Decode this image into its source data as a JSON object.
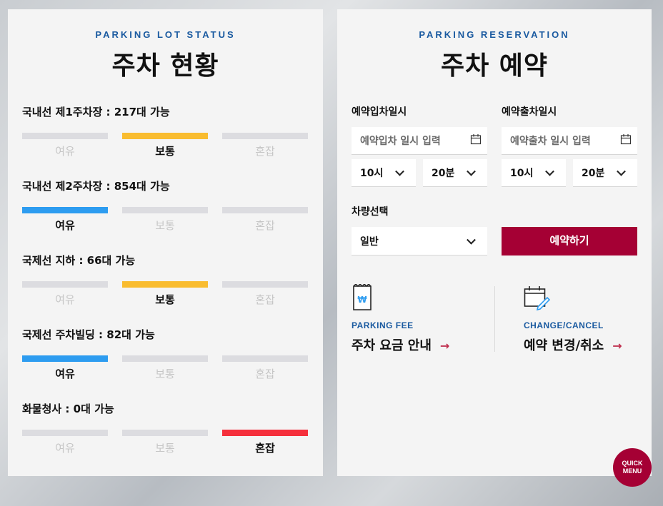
{
  "status": {
    "eyebrow": "PARKING LOT STATUS",
    "title": "주차 현황",
    "lots": [
      {
        "name": "국내선 제1주차장 : 217대 가능",
        "active": 1,
        "active_color": "#f9bc2f"
      },
      {
        "name": "국내선 제2주차장 : 854대 가능",
        "active": 0,
        "active_color": "#2d9cf0"
      },
      {
        "name": "국제선 지하 : 66대 가능",
        "active": 1,
        "active_color": "#f9bc2f"
      },
      {
        "name": "국제선 주차빌딩 : 82대 가능",
        "active": 0,
        "active_color": "#2d9cf0"
      },
      {
        "name": "화물청사 : 0대 가능",
        "active": 2,
        "active_color": "#f5303c"
      }
    ],
    "level_labels": [
      "여유",
      "보통",
      "혼잡"
    ]
  },
  "reservation": {
    "eyebrow": "PARKING RESERVATION",
    "title": "주차 예약",
    "entry_label": "예약입차일시",
    "exit_label": "예약출차일시",
    "entry_placeholder": "예약입차 일시 입력",
    "exit_placeholder": "예약출차 일시 입력",
    "entry_hour": "10시",
    "entry_minute": "20분",
    "exit_hour": "10시",
    "exit_minute": "20분",
    "vehicle_label": "차량선택",
    "vehicle_value": "일반",
    "submit_label": "예약하기",
    "links": [
      {
        "eyebrow": "PARKING FEE",
        "title": "주차 요금 안내",
        "icon": "receipt-won-icon"
      },
      {
        "eyebrow": "CHANGE/CANCEL",
        "title": "예약 변경/취소",
        "icon": "calendar-edit-icon"
      }
    ],
    "arrow": "→"
  },
  "quick_menu": {
    "line1": "QUICK",
    "line2": "MENU"
  },
  "colors": {
    "accent": "#a50034",
    "brand_blue": "#1a5aa0",
    "yellow": "#f9bc2f",
    "blue": "#2d9cf0",
    "red": "#f5303c"
  }
}
